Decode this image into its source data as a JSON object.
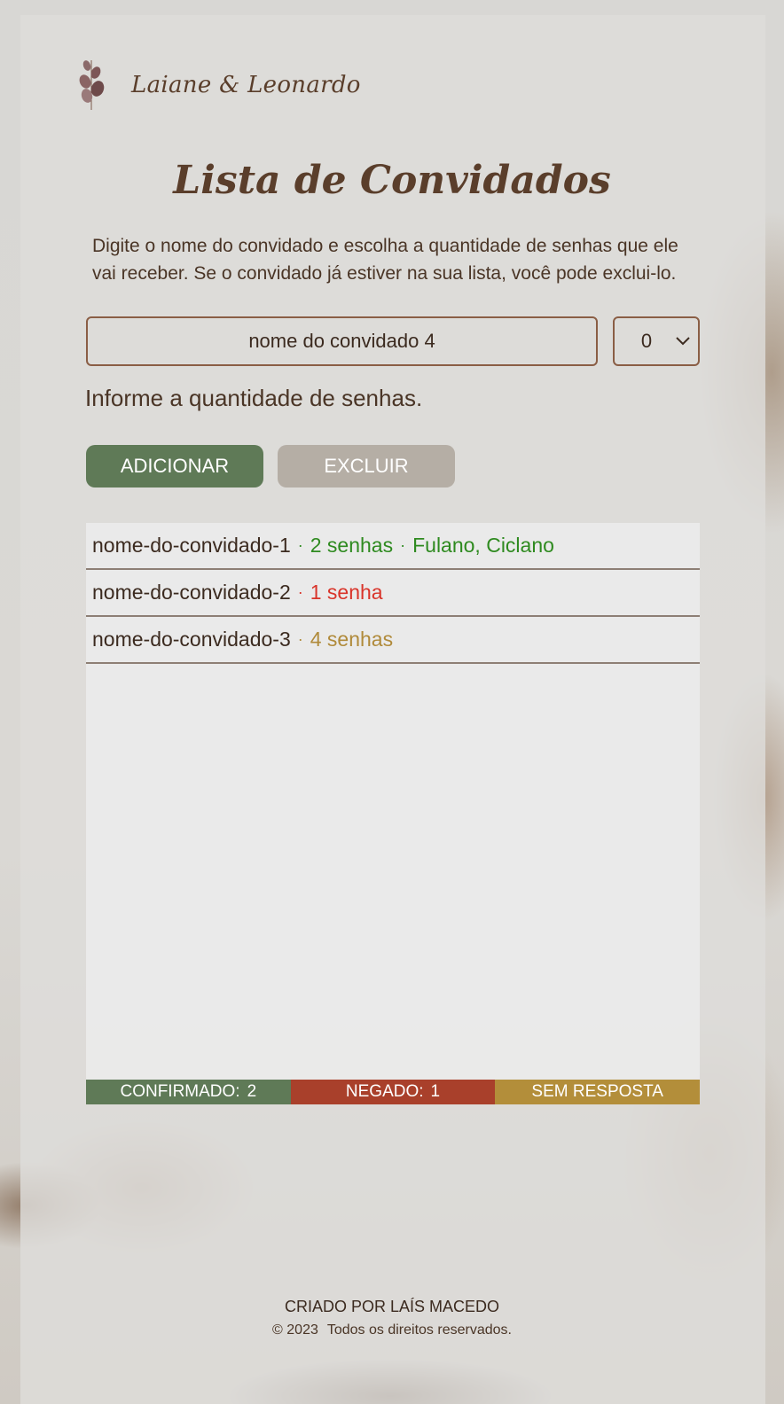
{
  "header": {
    "brand_name": "Laiane & Leonardo",
    "brand_icon": "eucalyptus-leaf-icon"
  },
  "main": {
    "title": "Lista de Convidados",
    "intro": "Digite o nome do convidado e escolha a quantidade de senhas que ele vai receber. Se o convidado já estiver na sua lista, você pode exclui-lo.",
    "name_input": {
      "value": "nome do convidado 4",
      "placeholder": ""
    },
    "quantity_select": {
      "selected": "0"
    },
    "hint": "Informe a quantidade de senhas.",
    "add_label": "ADICIONAR",
    "delete_label": "EXCLUIR"
  },
  "guests": [
    {
      "name": "nome-do-convidado-1",
      "seats": "2 senhas",
      "status": "confirmed",
      "companions": "Fulano, Ciclano"
    },
    {
      "name": "nome-do-convidado-2",
      "seats": "1 senha",
      "status": "denied",
      "companions": ""
    },
    {
      "name": "nome-do-convidado-3",
      "seats": "4 senhas",
      "status": "no-answer",
      "companions": ""
    }
  ],
  "stats": {
    "confirmed_label": "CONFIRMADO:",
    "confirmed_count": "2",
    "denied_label": "NEGADO:",
    "denied_count": "1",
    "no_answer_label": "SEM RESPOSTA"
  },
  "footer": {
    "credit": "CRIADO POR LAÍS MACEDO",
    "copyright": "© 2023",
    "rights": "Todos os direitos reservados."
  },
  "colors": {
    "accent_brown": "#5a3e2b",
    "confirmed": "#5f7a57",
    "denied": "#a9402b",
    "no_answer": "#b38e3a",
    "button_disabled": "#b5aea5"
  }
}
